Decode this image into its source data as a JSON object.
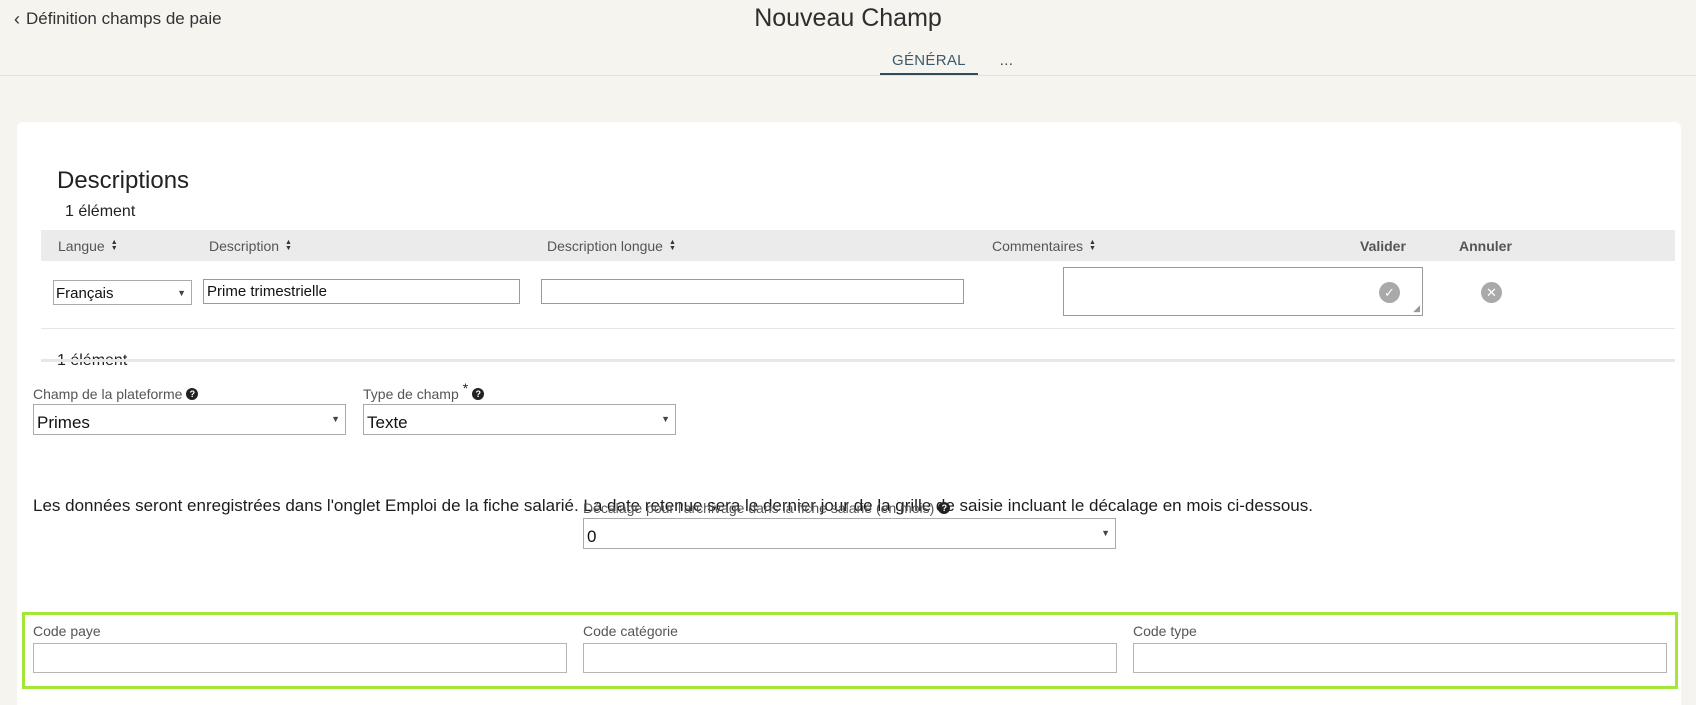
{
  "header": {
    "back_label": "Définition champs de paie",
    "title": "Nouveau Champ",
    "tabs": [
      {
        "label": "GÉNÉRAL",
        "active": true
      },
      {
        "label": "..."
      }
    ]
  },
  "descriptions": {
    "title": "Descriptions",
    "count_top": "1 élément",
    "count_bottom": "1 élément",
    "columns": {
      "langue": "Langue",
      "description": "Description",
      "description_longue": "Description longue",
      "commentaires": "Commentaires",
      "valider": "Valider",
      "annuler": "Annuler"
    },
    "row": {
      "langue": "Français",
      "description": "Prime trimestrielle",
      "description_longue": "",
      "commentaires": ""
    }
  },
  "form": {
    "champ_plateforme": {
      "label": "Champ de la plateforme",
      "value": "Primes"
    },
    "type_champ": {
      "label": "Type de champ",
      "required_mark": "*",
      "value": "Texte"
    },
    "info_text": "Les données seront enregistrées dans l'onglet Emploi de la fiche salarié. La date retenue sera le dernier jour de la grille de saisie incluant le décalage en mois ci-dessous.",
    "decalage": {
      "label": "Décalage pour l'archivage dans la fiche salarié (en mois)",
      "value": "0"
    },
    "code_paye": {
      "label": "Code paye",
      "value": ""
    },
    "code_categorie": {
      "label": "Code catégorie",
      "value": ""
    },
    "code_type": {
      "label": "Code type",
      "value": ""
    }
  },
  "colors": {
    "highlight_border": "#a3e635",
    "background": "#f6f4ef",
    "tab_underline": "#2f4b59"
  },
  "icons": [
    "chevron-left-icon",
    "sort-icon",
    "dropdown-arrow-icon",
    "help-icon",
    "validate-icon",
    "cancel-icon"
  ]
}
